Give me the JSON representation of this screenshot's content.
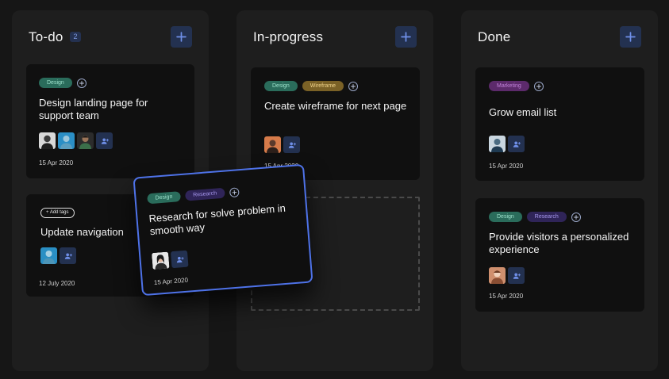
{
  "columns": [
    {
      "title": "To-do",
      "count": "2",
      "cards": [
        {
          "tags": [
            "Design"
          ],
          "title": "Design landing page for support team",
          "avatars": [
            "person-1",
            "person-2",
            "person-3"
          ],
          "date": "15 Apr 2020"
        },
        {
          "add_tags_label": "+ Add tags",
          "title": "Update navigation",
          "avatars": [
            "person-4"
          ],
          "date": "12 July 2020"
        }
      ]
    },
    {
      "title": "In-progress",
      "cards": [
        {
          "tags": [
            "Design",
            "Wireframe"
          ],
          "title": "Create wireframe for next page",
          "avatars": [
            "person-5"
          ],
          "date": "15 Apr 2020"
        }
      ]
    },
    {
      "title": "Done",
      "cards": [
        {
          "tags": [
            "Marketing"
          ],
          "title": "Grow email list",
          "avatars": [
            "person-6"
          ],
          "date": "15 Apr 2020"
        },
        {
          "tags": [
            "Design",
            "Research"
          ],
          "title": "Provide visitors a personalized experience",
          "avatars": [
            "person-7"
          ],
          "date": "15 Apr 2020"
        }
      ]
    }
  ],
  "dragging_card": {
    "tags": [
      "Design",
      "Research"
    ],
    "title": "Research for solve problem in smooth way",
    "avatars": [
      "person-8"
    ],
    "date": "15 Apr 2020"
  },
  "icons": {
    "add": "plus-icon",
    "add_tag": "plus-circle-icon",
    "add_member": "user-plus-icon"
  },
  "colors": {
    "background": "#161616",
    "column": "#1e1e1e",
    "card": "#101010",
    "accent": "#4e72e8",
    "accent_bg": "#233150",
    "tag_design": "#2a6c5b",
    "tag_wireframe": "#7a6126",
    "tag_marketing": "#5c2a6b",
    "tag_research": "#2f2458"
  }
}
